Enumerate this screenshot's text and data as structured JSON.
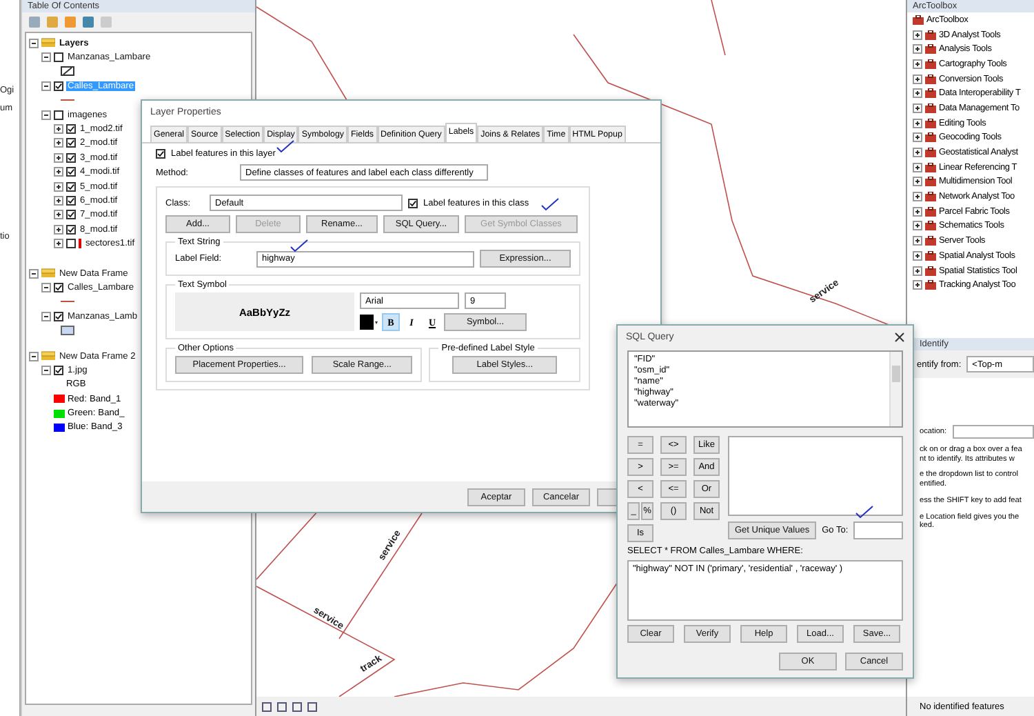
{
  "left_edge": {
    "fragments": [
      "Ogi",
      "um",
      "tio"
    ]
  },
  "toc": {
    "title": "Table Of Contents",
    "tree": [
      {
        "kind": "frame",
        "label": "Layers",
        "expanded": true,
        "children": [
          {
            "kind": "layer",
            "label": "Manzanas_Lambare",
            "checked": false,
            "selected": false,
            "expanded": true,
            "children": [
              {
                "kind": "legend-outline"
              }
            ]
          },
          {
            "kind": "layer",
            "label": "Calles_Lambare",
            "checked": true,
            "selected": true,
            "expanded": true,
            "children": [
              {
                "kind": "legend-line"
              }
            ]
          },
          {
            "kind": "layer",
            "label": "imagenes",
            "checked": false,
            "selected": false,
            "expanded": true,
            "children": [
              {
                "kind": "layer",
                "label": "1_mod2.tif",
                "checked": true,
                "selected": false,
                "expanded": false
              },
              {
                "kind": "layer",
                "label": "2_mod.tif",
                "checked": true,
                "selected": false,
                "expanded": false
              },
              {
                "kind": "layer",
                "label": "3_mod.tif",
                "checked": true,
                "selected": false,
                "expanded": false
              },
              {
                "kind": "layer",
                "label": "4_modi.tif",
                "checked": true,
                "selected": false,
                "expanded": false
              },
              {
                "kind": "layer",
                "label": "5_mod.tif",
                "checked": true,
                "selected": false,
                "expanded": false
              },
              {
                "kind": "layer",
                "label": "6_mod.tif",
                "checked": true,
                "selected": false,
                "expanded": false
              },
              {
                "kind": "layer",
                "label": "7_mod.tif",
                "checked": true,
                "selected": false,
                "expanded": false
              },
              {
                "kind": "layer",
                "label": "8_mod.tif",
                "checked": true,
                "selected": false,
                "expanded": false
              },
              {
                "kind": "layer",
                "label": "sectores1.tif",
                "checked": false,
                "selected": false,
                "expanded": false,
                "broken": true
              }
            ]
          }
        ]
      },
      {
        "kind": "frame",
        "label": "New Data Frame",
        "expanded": true,
        "children": [
          {
            "kind": "layer",
            "label": "Calles_Lambare",
            "checked": true,
            "selected": false,
            "expanded": true,
            "children": [
              {
                "kind": "legend-line"
              }
            ]
          },
          {
            "kind": "layer",
            "label": "Manzanas_Lamb",
            "checked": true,
            "selected": false,
            "expanded": true,
            "children": [
              {
                "kind": "legend-fill"
              }
            ]
          }
        ]
      },
      {
        "kind": "frame",
        "label": "New Data Frame 2",
        "expanded": true,
        "children": [
          {
            "kind": "layer",
            "label": "1.jpg",
            "checked": true,
            "selected": false,
            "expanded": true,
            "children": [
              {
                "kind": "heading",
                "label": "RGB"
              },
              {
                "kind": "band",
                "color": "#ff0000",
                "name": "Red:",
                "value": "Band_1"
              },
              {
                "kind": "band",
                "color": "#00dd00",
                "name": "Green:",
                "value": "Band_"
              },
              {
                "kind": "band",
                "color": "#0000ff",
                "name": "Blue:",
                "value": "Band_3"
              }
            ]
          }
        ]
      }
    ]
  },
  "map": {
    "labels": [
      "service",
      "service",
      "service",
      "track"
    ]
  },
  "layer_properties": {
    "title": "Layer Properties",
    "tabs": [
      {
        "label": "General",
        "selected": false
      },
      {
        "label": "Source",
        "selected": false
      },
      {
        "label": "Selection",
        "selected": false
      },
      {
        "label": "Display",
        "selected": false
      },
      {
        "label": "Symbology",
        "selected": false
      },
      {
        "label": "Fields",
        "selected": false
      },
      {
        "label": "Definition Query",
        "selected": false
      },
      {
        "label": "Labels",
        "selected": true
      },
      {
        "label": "Joins & Relates",
        "selected": false
      },
      {
        "label": "Time",
        "selected": false
      },
      {
        "label": "HTML Popup",
        "selected": false
      }
    ],
    "label_layer": {
      "label": "Label features in this layer",
      "checked": true
    },
    "method": {
      "label": "Method:",
      "value": "Define classes of features and label each class differently"
    },
    "class_label": "Class:",
    "class_value": "Default",
    "label_class": {
      "label": "Label features in this class",
      "checked": true
    },
    "class_buttons": [
      {
        "label": "Add...",
        "disabled": false
      },
      {
        "label": "Delete",
        "disabled": true
      },
      {
        "label": "Rename...",
        "disabled": false
      },
      {
        "label": "SQL Query...",
        "disabled": false
      },
      {
        "label": "Get Symbol Classes",
        "disabled": true
      }
    ],
    "text_string": {
      "title": "Text String",
      "field_label": "Label Field:",
      "field_value": "highway",
      "button": "Expression..."
    },
    "text_symbol": {
      "title": "Text Symbol",
      "preview": "AaBbYyZz",
      "font": "Arial",
      "size": "9",
      "bold": {
        "label": "B",
        "on": true
      },
      "italic": {
        "label": "I",
        "on": false
      },
      "underline": {
        "label": "U",
        "on": false
      },
      "button": "Symbol..."
    },
    "other_options": {
      "title": "Other Options",
      "buttons": [
        "Placement Properties...",
        "Scale Range..."
      ]
    },
    "predefined": {
      "title": "Pre-defined Label Style",
      "button": "Label Styles..."
    },
    "footer_buttons": [
      "Aceptar",
      "Cancelar"
    ]
  },
  "sql_query": {
    "title": "SQL Query",
    "fields": [
      "\"FID\"",
      "\"osm_id\"",
      "\"name\"",
      "\"highway\"",
      "\"waterway\""
    ],
    "operator_rows": [
      [
        [
          "="
        ],
        [
          "<>"
        ],
        [
          "Like"
        ]
      ],
      [
        [
          ">"
        ],
        [
          ">="
        ],
        [
          "And"
        ]
      ],
      [
        [
          "<"
        ],
        [
          "<="
        ],
        [
          "Or"
        ]
      ],
      [
        [
          "_",
          "%"
        ],
        [
          "()"
        ],
        [
          "Not"
        ]
      ],
      [
        [
          "Is"
        ]
      ]
    ],
    "unique_button": "Get Unique Values",
    "goto_label": "Go To:",
    "select_label": "SELECT * FROM Calles_Lambare WHERE:",
    "expression": "\"highway\" NOT IN ('primary', 'residential' , 'raceway' )",
    "buttons": [
      "Clear",
      "Verify",
      "Help",
      "Load...",
      "Save..."
    ],
    "ok": "OK",
    "cancel": "Cancel"
  },
  "toolbox": {
    "title": "ArcToolbox",
    "root": "ArcToolbox",
    "items": [
      "3D Analyst Tools",
      "Analysis Tools",
      "Cartography Tools",
      "Conversion Tools",
      "Data Interoperability T",
      "Data Management To",
      "Editing Tools",
      "Geocoding Tools",
      "Geostatistical Analyst",
      "Linear Referencing T",
      "Multidimension Tool",
      "Network Analyst Too",
      "Parcel Fabric Tools",
      "Schematics Tools",
      "Server Tools",
      "Spatial Analyst Tools",
      "Spatial Statistics Tool",
      "Tracking Analyst Too"
    ]
  },
  "identify": {
    "title": "Identify",
    "from_label": "entify from:",
    "from_value": "<Top-m",
    "location_label": "ocation:",
    "help": [
      "ck on or drag a box over a fea\nnt to identify. Its attributes w",
      "e the dropdown list to control\nentified.",
      "ess the SHIFT key to add feat",
      "e Location field gives you the\nked."
    ],
    "status": "No identified features"
  }
}
